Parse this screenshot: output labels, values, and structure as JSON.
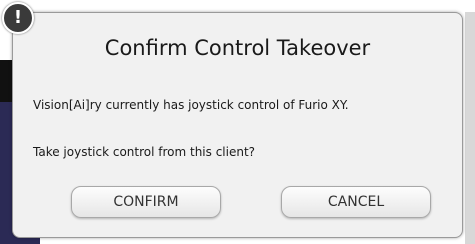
{
  "dialog": {
    "alert_icon_glyph": "!",
    "title": "Confirm Control Takeover",
    "message_line1": "Vision[Ai]ry currently has joystick control of Furio XY.",
    "message_line2": "Take joystick control from this client?",
    "confirm_label": "CONFIRM",
    "cancel_label": "CANCEL"
  },
  "icons": {
    "alert": "exclamation-icon"
  },
  "colors": {
    "dialog_background": "#f1f1f1",
    "badge_background": "#3a3a3a",
    "text": "#1a1a1a",
    "button_text": "#333333"
  }
}
